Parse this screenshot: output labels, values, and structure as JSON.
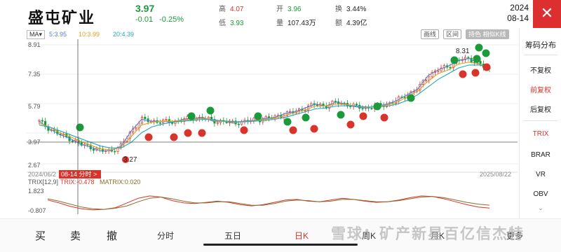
{
  "header": {
    "stock_name": "盛屯矿业",
    "price": "3.97",
    "change": "-0.01",
    "change_pct": "-0.25%",
    "high_label": "高",
    "high_value": "4.07",
    "low_label": "低",
    "low_value": "3.93",
    "open_label": "开",
    "open_value": "3.96",
    "volume_label": "量",
    "volume_value": "107.43万",
    "turnover_label": "换",
    "turnover_value": "3.44%",
    "amount_label": "额",
    "amount_value": "4.39亿",
    "date_year": "2024",
    "date_md": "08-14",
    "close_icon": "close-icon"
  },
  "toolbar": {
    "ma_select": "MA",
    "ma5": "5:3.95",
    "ma10": "10:3.99",
    "ma20": "20:4.39",
    "btn_draw": "画线",
    "btn_range": "区间",
    "btn_special": "持色 相似K线",
    "colors": {
      "ma5": "#5a7fd6",
      "ma10": "#e0a020",
      "ma20": "#25a8b8"
    }
  },
  "axis": {
    "y_labels": [
      "8.91",
      "7.35",
      "5.79",
      "3.97",
      "2.67"
    ],
    "date_left": "2024/06/2",
    "date_cursor": "08-14 分时 >",
    "date_right": "2025/08/22",
    "max_label": "8.31",
    "min_label": "3.27"
  },
  "trix": {
    "legend_name": "TRIX[12,9]",
    "legend_trix": "TRIX:-0.478",
    "legend_matrix": "MATRIX:0.020",
    "y_top": "1.823",
    "y_bottom": "-0.807"
  },
  "sidebar": {
    "title": "筹码分布",
    "items": [
      "不复权",
      "前复权",
      "后复权"
    ],
    "indicators": [
      "TRIX",
      "BRAR",
      "VR",
      "OBV"
    ]
  },
  "bottom_nav": {
    "buy": "买",
    "sell": "卖",
    "cancel": "撤",
    "tabs": [
      "分时",
      "五日",
      "日K",
      "周K",
      "月K",
      "更多"
    ]
  },
  "watermark": "雪球：矿产新星百亿信杰特",
  "chart_data": {
    "type": "line",
    "title": "",
    "x": [
      "2024/06/2",
      "2025/08/22"
    ],
    "ylim": [
      2.67,
      8.91
    ],
    "series": [
      {
        "name": "MA5",
        "values": [
          4.9,
          4.5,
          4.2,
          4.0,
          3.7,
          3.55,
          3.35,
          3.35,
          3.6,
          4.4,
          5.0,
          4.9,
          4.9,
          4.85,
          5.0,
          5.05,
          5.1,
          4.9,
          4.9,
          4.8,
          4.9,
          4.95,
          5.05,
          5.1,
          5.3,
          5.4,
          5.6,
          5.8,
          5.7,
          5.9,
          5.8,
          5.65,
          5.6,
          5.7,
          5.8,
          6.0,
          6.3,
          6.6,
          7.3,
          7.6,
          7.8,
          8.1,
          8.2,
          7.9,
          7.6
        ]
      },
      {
        "name": "MA10",
        "values": [
          4.8,
          4.6,
          4.3,
          4.1,
          3.85,
          3.65,
          3.45,
          3.4,
          3.55,
          4.1,
          4.7,
          4.85,
          4.9,
          4.9,
          4.95,
          5.0,
          5.05,
          4.95,
          4.9,
          4.85,
          4.88,
          4.92,
          5.0,
          5.05,
          5.2,
          5.35,
          5.5,
          5.7,
          5.7,
          5.8,
          5.78,
          5.7,
          5.62,
          5.68,
          5.75,
          5.9,
          6.2,
          6.5,
          7.0,
          7.4,
          7.6,
          7.9,
          8.0,
          7.9,
          7.7
        ]
      },
      {
        "name": "MA20",
        "values": [
          4.7,
          4.6,
          4.4,
          4.2,
          4.0,
          3.8,
          3.6,
          3.5,
          3.5,
          3.8,
          4.3,
          4.6,
          4.75,
          4.85,
          4.9,
          4.95,
          5.0,
          4.98,
          4.92,
          4.88,
          4.87,
          4.9,
          4.95,
          5.0,
          5.1,
          5.25,
          5.4,
          5.55,
          5.6,
          5.7,
          5.72,
          5.7,
          5.65,
          5.65,
          5.7,
          5.8,
          6.0,
          6.3,
          6.7,
          7.1,
          7.4,
          7.7,
          7.85,
          7.85,
          7.75
        ]
      }
    ],
    "trix_series": [
      {
        "name": "TRIX",
        "values": [
          0.9,
          0.4,
          -0.2,
          -0.6,
          -0.8,
          -0.7,
          -0.4,
          0.4,
          1.2,
          1.6,
          1.4,
          0.8,
          0.4,
          0.3,
          0.5,
          0.7,
          0.5,
          0.1,
          -0.1,
          0.1,
          0.5,
          0.9,
          1.0,
          0.7,
          0.6,
          0.9,
          1.2,
          1.0,
          0.7,
          0.5,
          0.6,
          0.9,
          1.3,
          1.6,
          1.5,
          1.1,
          0.6,
          0.1,
          -0.3,
          -0.478
        ]
      },
      {
        "name": "MATRIX",
        "values": [
          1.1,
          0.7,
          0.2,
          -0.3,
          -0.6,
          -0.7,
          -0.5,
          -0.1,
          0.6,
          1.2,
          1.4,
          1.1,
          0.7,
          0.4,
          0.4,
          0.6,
          0.6,
          0.3,
          0.0,
          0.0,
          0.3,
          0.7,
          0.9,
          0.8,
          0.6,
          0.7,
          1.0,
          1.0,
          0.8,
          0.6,
          0.6,
          0.8,
          1.1,
          1.4,
          1.5,
          1.3,
          0.9,
          0.5,
          0.2,
          0.02
        ]
      }
    ],
    "trix_ylim": [
      -0.807,
      1.823
    ]
  }
}
